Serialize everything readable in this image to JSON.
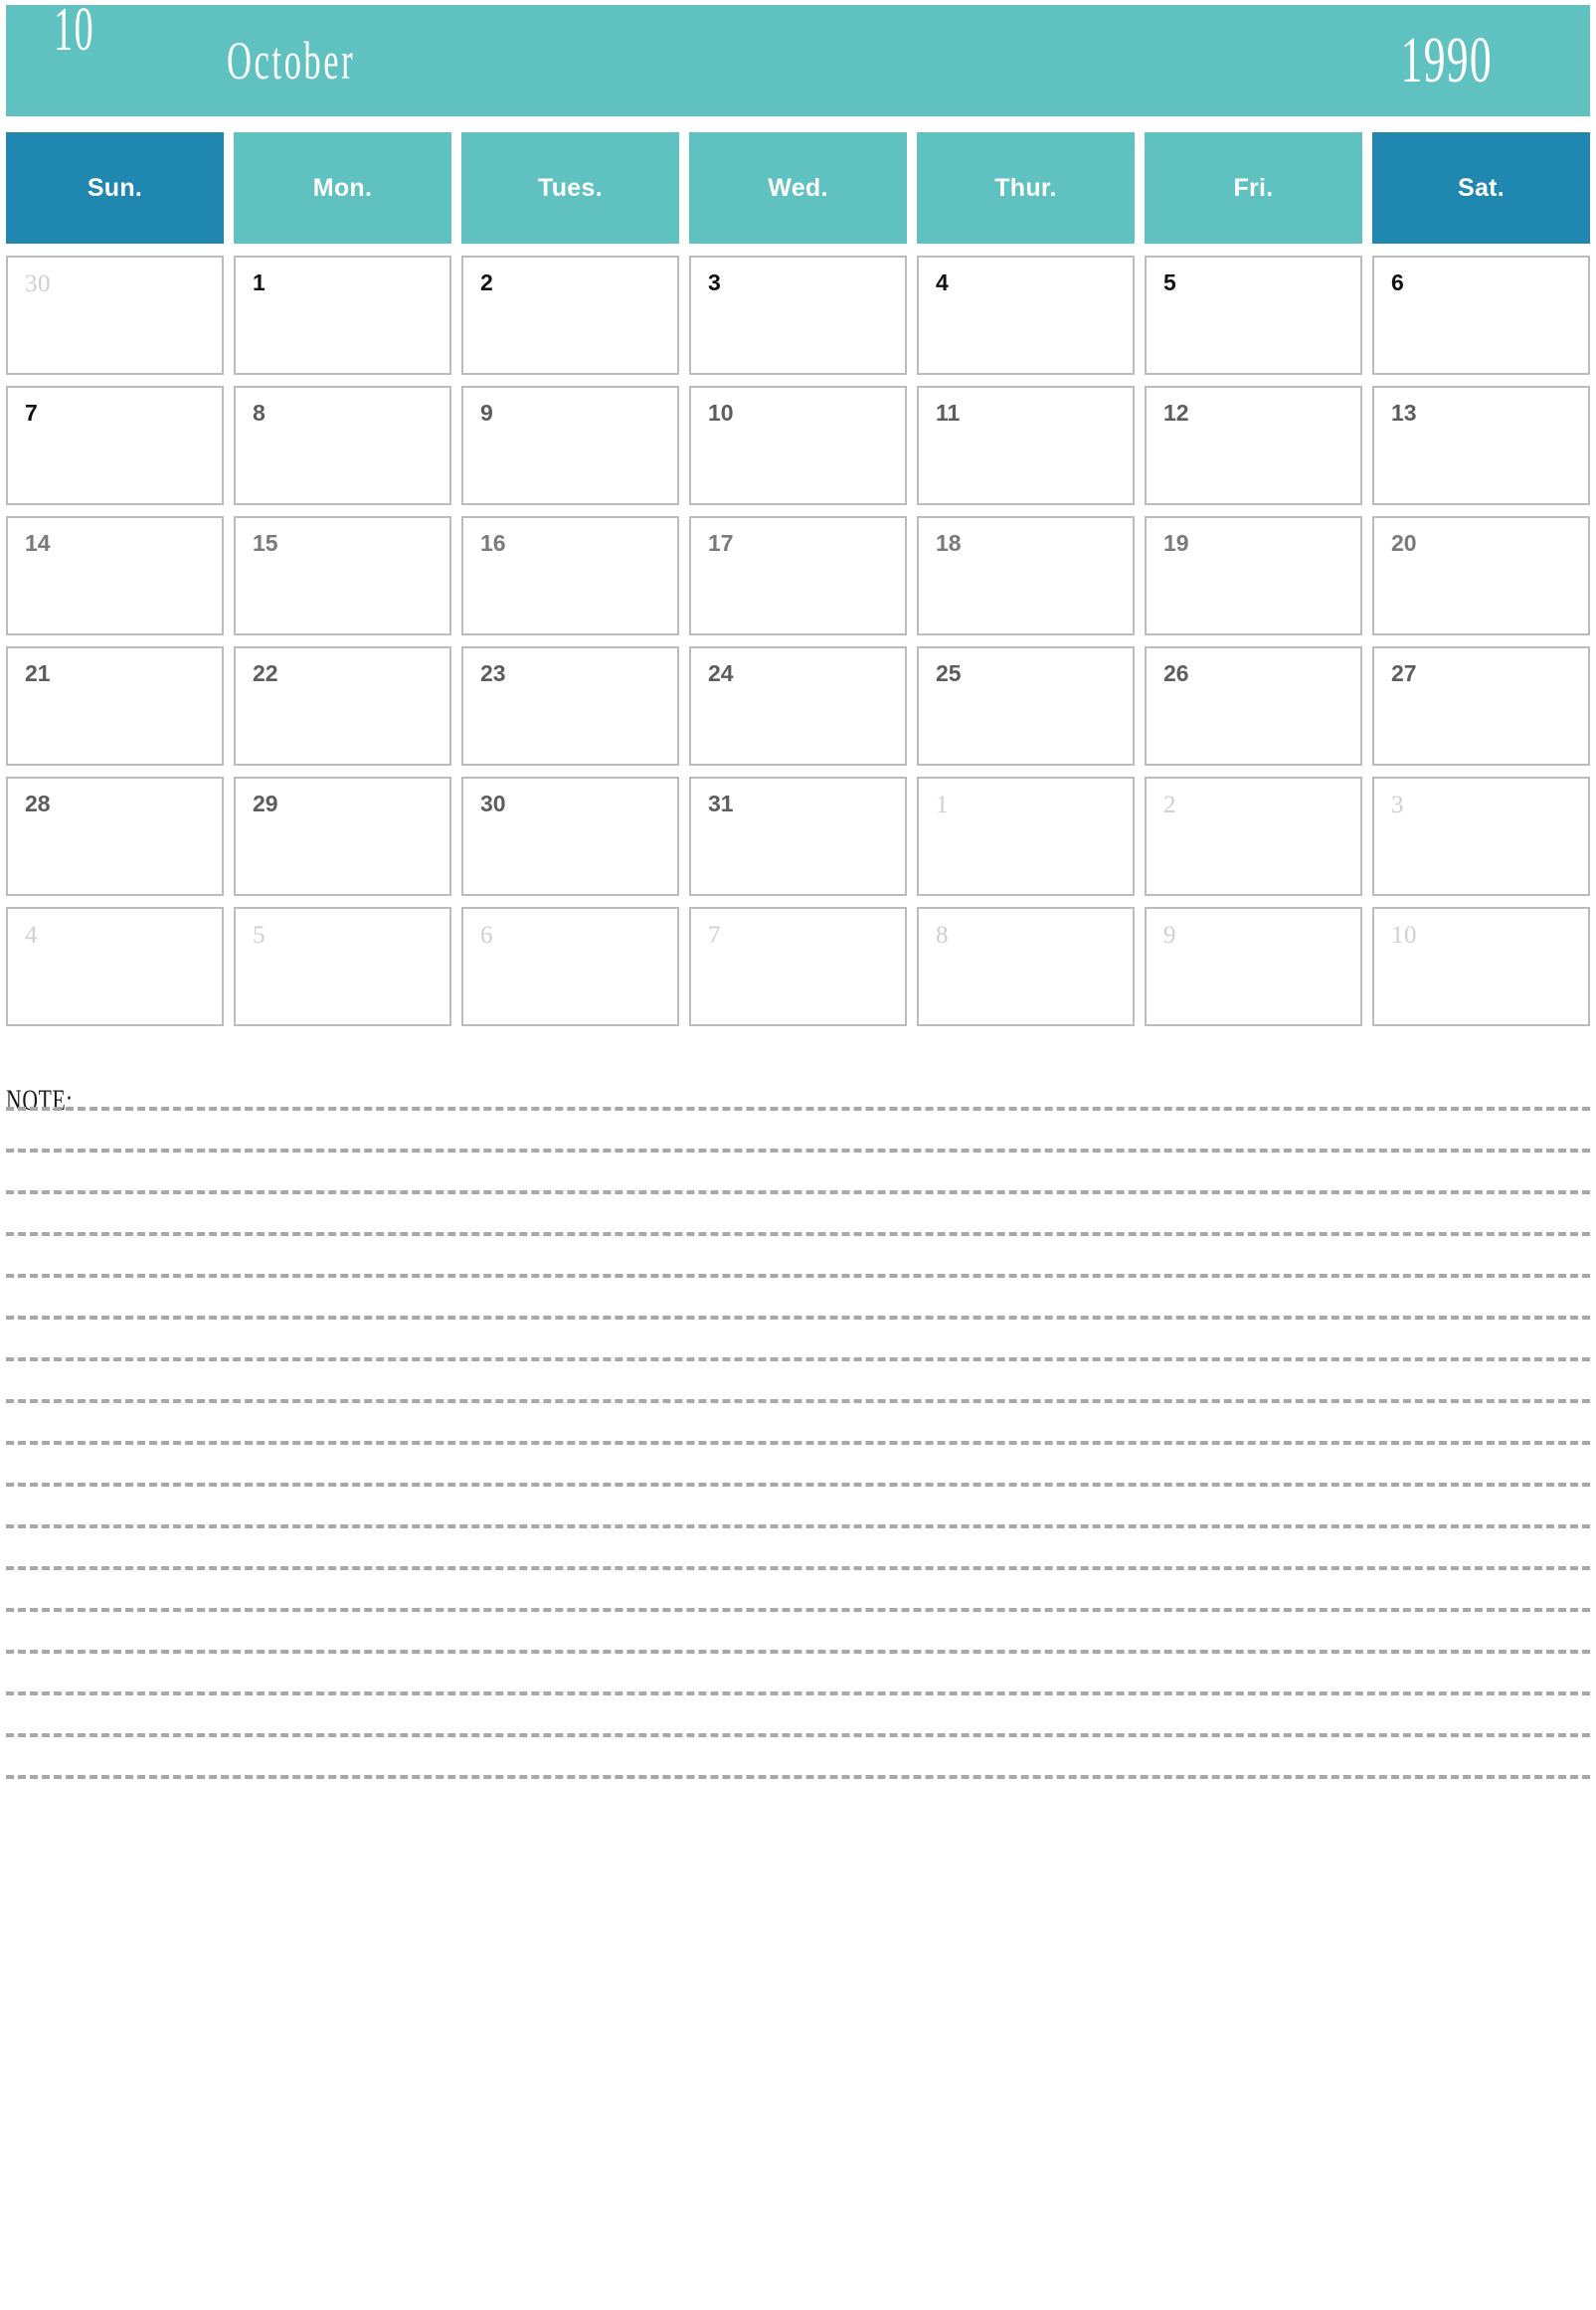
{
  "header": {
    "month_number": "10",
    "month_name": "October",
    "year": "1990",
    "band_color": "#5fc1c0"
  },
  "weekdays": [
    {
      "label": "Sun.",
      "weekend": true,
      "color": "#1f87b0"
    },
    {
      "label": "Mon.",
      "weekend": false,
      "color": "#5fc1c0"
    },
    {
      "label": "Tues.",
      "weekend": false,
      "color": "#5fc1c0"
    },
    {
      "label": "Wed.",
      "weekend": false,
      "color": "#5fc1c0"
    },
    {
      "label": "Thur.",
      "weekend": false,
      "color": "#5fc1c0"
    },
    {
      "label": "Fri.",
      "weekend": false,
      "color": "#5fc1c0"
    },
    {
      "label": "Sat.",
      "weekend": true,
      "color": "#1f87b0"
    }
  ],
  "weeks": [
    [
      {
        "day": "30",
        "in_month": false,
        "emphasis": "faint"
      },
      {
        "day": "1",
        "in_month": true,
        "emphasis": "strong"
      },
      {
        "day": "2",
        "in_month": true,
        "emphasis": "strong"
      },
      {
        "day": "3",
        "in_month": true,
        "emphasis": "strong"
      },
      {
        "day": "4",
        "in_month": true,
        "emphasis": "strong"
      },
      {
        "day": "5",
        "in_month": true,
        "emphasis": "strong"
      },
      {
        "day": "6",
        "in_month": true,
        "emphasis": "strong"
      }
    ],
    [
      {
        "day": "7",
        "in_month": true,
        "emphasis": "strong"
      },
      {
        "day": "8",
        "in_month": true,
        "emphasis": "mid"
      },
      {
        "day": "9",
        "in_month": true,
        "emphasis": "mid"
      },
      {
        "day": "10",
        "in_month": true,
        "emphasis": "mid"
      },
      {
        "day": "11",
        "in_month": true,
        "emphasis": "mid"
      },
      {
        "day": "12",
        "in_month": true,
        "emphasis": "mid"
      },
      {
        "day": "13",
        "in_month": true,
        "emphasis": "mid"
      }
    ],
    [
      {
        "day": "14",
        "in_month": true,
        "emphasis": "normal"
      },
      {
        "day": "15",
        "in_month": true,
        "emphasis": "normal"
      },
      {
        "day": "16",
        "in_month": true,
        "emphasis": "normal"
      },
      {
        "day": "17",
        "in_month": true,
        "emphasis": "normal"
      },
      {
        "day": "18",
        "in_month": true,
        "emphasis": "normal"
      },
      {
        "day": "19",
        "in_month": true,
        "emphasis": "normal"
      },
      {
        "day": "20",
        "in_month": true,
        "emphasis": "normal"
      }
    ],
    [
      {
        "day": "21",
        "in_month": true,
        "emphasis": "mid"
      },
      {
        "day": "22",
        "in_month": true,
        "emphasis": "mid"
      },
      {
        "day": "23",
        "in_month": true,
        "emphasis": "mid"
      },
      {
        "day": "24",
        "in_month": true,
        "emphasis": "mid"
      },
      {
        "day": "25",
        "in_month": true,
        "emphasis": "mid"
      },
      {
        "day": "26",
        "in_month": true,
        "emphasis": "mid"
      },
      {
        "day": "27",
        "in_month": true,
        "emphasis": "mid"
      }
    ],
    [
      {
        "day": "28",
        "in_month": true,
        "emphasis": "mid"
      },
      {
        "day": "29",
        "in_month": true,
        "emphasis": "mid"
      },
      {
        "day": "30",
        "in_month": true,
        "emphasis": "mid"
      },
      {
        "day": "31",
        "in_month": true,
        "emphasis": "mid"
      },
      {
        "day": "1",
        "in_month": false,
        "emphasis": "faint"
      },
      {
        "day": "2",
        "in_month": false,
        "emphasis": "faint"
      },
      {
        "day": "3",
        "in_month": false,
        "emphasis": "faint"
      }
    ],
    [
      {
        "day": "4",
        "in_month": false,
        "emphasis": "faint"
      },
      {
        "day": "5",
        "in_month": false,
        "emphasis": "faint"
      },
      {
        "day": "6",
        "in_month": false,
        "emphasis": "faint"
      },
      {
        "day": "7",
        "in_month": false,
        "emphasis": "faint"
      },
      {
        "day": "8",
        "in_month": false,
        "emphasis": "faint"
      },
      {
        "day": "9",
        "in_month": false,
        "emphasis": "faint"
      },
      {
        "day": "10",
        "in_month": false,
        "emphasis": "faint"
      }
    ]
  ],
  "note": {
    "label": "NOTE:",
    "line_count": 17,
    "line_color": "#a8a8a8"
  }
}
